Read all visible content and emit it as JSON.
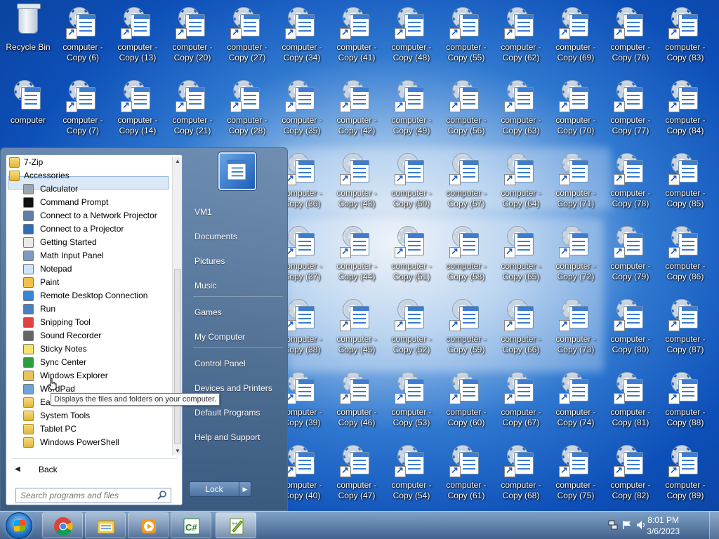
{
  "desktop": {
    "recycle_bin": "Recycle Bin",
    "computer": "computer",
    "copy_label_prefix": "computer -",
    "copy_numbers": [
      6,
      13,
      20,
      27,
      34,
      41,
      48,
      55,
      62,
      69,
      76,
      83,
      7,
      14,
      21,
      28,
      35,
      42,
      49,
      56,
      63,
      70,
      77,
      84,
      36,
      43,
      50,
      57,
      64,
      71,
      78,
      85,
      37,
      44,
      51,
      58,
      65,
      72,
      79,
      86,
      38,
      45,
      52,
      59,
      66,
      73,
      80,
      87,
      39,
      46,
      53,
      60,
      67,
      74,
      81,
      88,
      40,
      47,
      54,
      61,
      68,
      75,
      82,
      89
    ]
  },
  "start_menu": {
    "programs": [
      {
        "label": "7-Zip",
        "icon": "folder-icon",
        "indent": 0
      },
      {
        "label": "Accessories",
        "icon": "folder-icon",
        "indent": 0,
        "selected": true
      },
      {
        "label": "Calculator",
        "icon": "calculator-icon",
        "indent": 1
      },
      {
        "label": "Command Prompt",
        "icon": "command-prompt-icon",
        "indent": 1
      },
      {
        "label": "Connect to a Network Projector",
        "icon": "network-projector-icon",
        "indent": 1
      },
      {
        "label": "Connect to a Projector",
        "icon": "projector-icon",
        "indent": 1
      },
      {
        "label": "Getting Started",
        "icon": "getting-started-icon",
        "indent": 1
      },
      {
        "label": "Math Input Panel",
        "icon": "math-input-icon",
        "indent": 1
      },
      {
        "label": "Notepad",
        "icon": "notepad-icon",
        "indent": 1
      },
      {
        "label": "Paint",
        "icon": "paint-icon",
        "indent": 1
      },
      {
        "label": "Remote Desktop Connection",
        "icon": "remote-desktop-icon",
        "indent": 1
      },
      {
        "label": "Run",
        "icon": "run-icon",
        "indent": 1
      },
      {
        "label": "Snipping Tool",
        "icon": "snipping-tool-icon",
        "indent": 1
      },
      {
        "label": "Sound Recorder",
        "icon": "microphone-icon",
        "indent": 1
      },
      {
        "label": "Sticky Notes",
        "icon": "sticky-notes-icon",
        "indent": 1
      },
      {
        "label": "Sync Center",
        "icon": "sync-center-icon",
        "indent": 1
      },
      {
        "label": "Windows Explorer",
        "icon": "windows-explorer-icon",
        "indent": 1
      },
      {
        "label": "WordPad",
        "icon": "wordpad-icon",
        "indent": 1
      },
      {
        "label": "Eas",
        "icon": "folder-icon",
        "indent": 1
      },
      {
        "label": "System Tools",
        "icon": "folder-icon",
        "indent": 1
      },
      {
        "label": "Tablet PC",
        "icon": "folder-icon",
        "indent": 1
      },
      {
        "label": "Windows PowerShell",
        "icon": "folder-icon",
        "indent": 1
      }
    ],
    "back_label": "Back",
    "search_placeholder": "Search programs and files",
    "right_items": [
      "VM1",
      "Documents",
      "Pictures",
      "Music",
      "Games",
      "My Computer",
      "Control Panel",
      "Devices and Printers",
      "Default Programs",
      "Help and Support"
    ],
    "lock_label": "Lock",
    "tooltip": "Displays the files and folders on your computer."
  },
  "taskbar": {
    "buttons": [
      "chrome-icon",
      "file-explorer-icon",
      "media-player-icon",
      "csharp-icon",
      "notepad-plus-icon"
    ],
    "time": "8:01 PM",
    "date": "3/6/2023"
  },
  "colors": {
    "desktop_blue": "#0d4fb8",
    "selection": "#dbe8f7",
    "taskbar": "#46648c"
  }
}
